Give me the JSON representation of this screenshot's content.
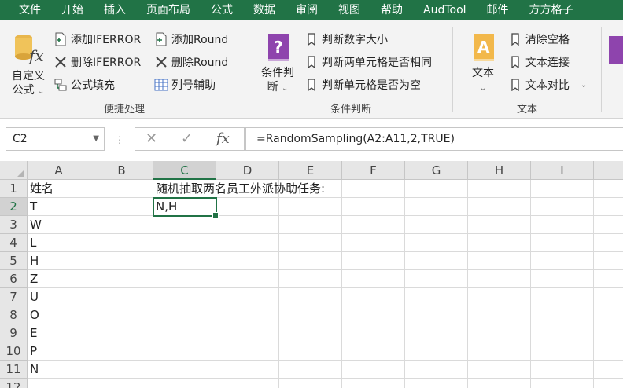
{
  "menu": [
    "文件",
    "开始",
    "插入",
    "页面布局",
    "公式",
    "数据",
    "审阅",
    "视图",
    "帮助",
    "AudTool",
    "邮件",
    "方方格子"
  ],
  "ribbon": {
    "group1": {
      "big_label_1": "自定义",
      "big_label_2": "公式",
      "buttons": [
        "添加IFERROR",
        "删除IFERROR",
        "公式填充",
        "添加Round",
        "删除Round",
        "列号辅助"
      ],
      "label": "便捷处理"
    },
    "group2": {
      "big_label_1": "条件判",
      "big_label_2": "断",
      "buttons": [
        "判断数字大小",
        "判断两单元格是否相同",
        "判断单元格是否为空"
      ],
      "label": "条件判断"
    },
    "group3": {
      "big_label": "文本",
      "buttons": [
        "清除空格",
        "文本连接",
        "文本对比"
      ],
      "label": "文本"
    }
  },
  "formula_bar": {
    "name_box": "C2",
    "formula": "=RandomSampling(A2:A11,2,TRUE)"
  },
  "sheet": {
    "columns": [
      "A",
      "B",
      "C",
      "D",
      "E",
      "F",
      "G",
      "H",
      "I"
    ],
    "rows": [
      "1",
      "2",
      "3",
      "4",
      "5",
      "6",
      "7",
      "8",
      "9",
      "10",
      "11",
      "12"
    ],
    "colA": [
      "姓名",
      "T",
      "W",
      "L",
      "H",
      "Z",
      "U",
      "O",
      "E",
      "P",
      "N"
    ],
    "c1": "随机抽取两名员工外派协助任务:",
    "c2": "N,H"
  },
  "colors": {
    "brand": "#217346",
    "ribbon_bg": "#f3f3f3",
    "header_bg": "#e6e6e6"
  }
}
